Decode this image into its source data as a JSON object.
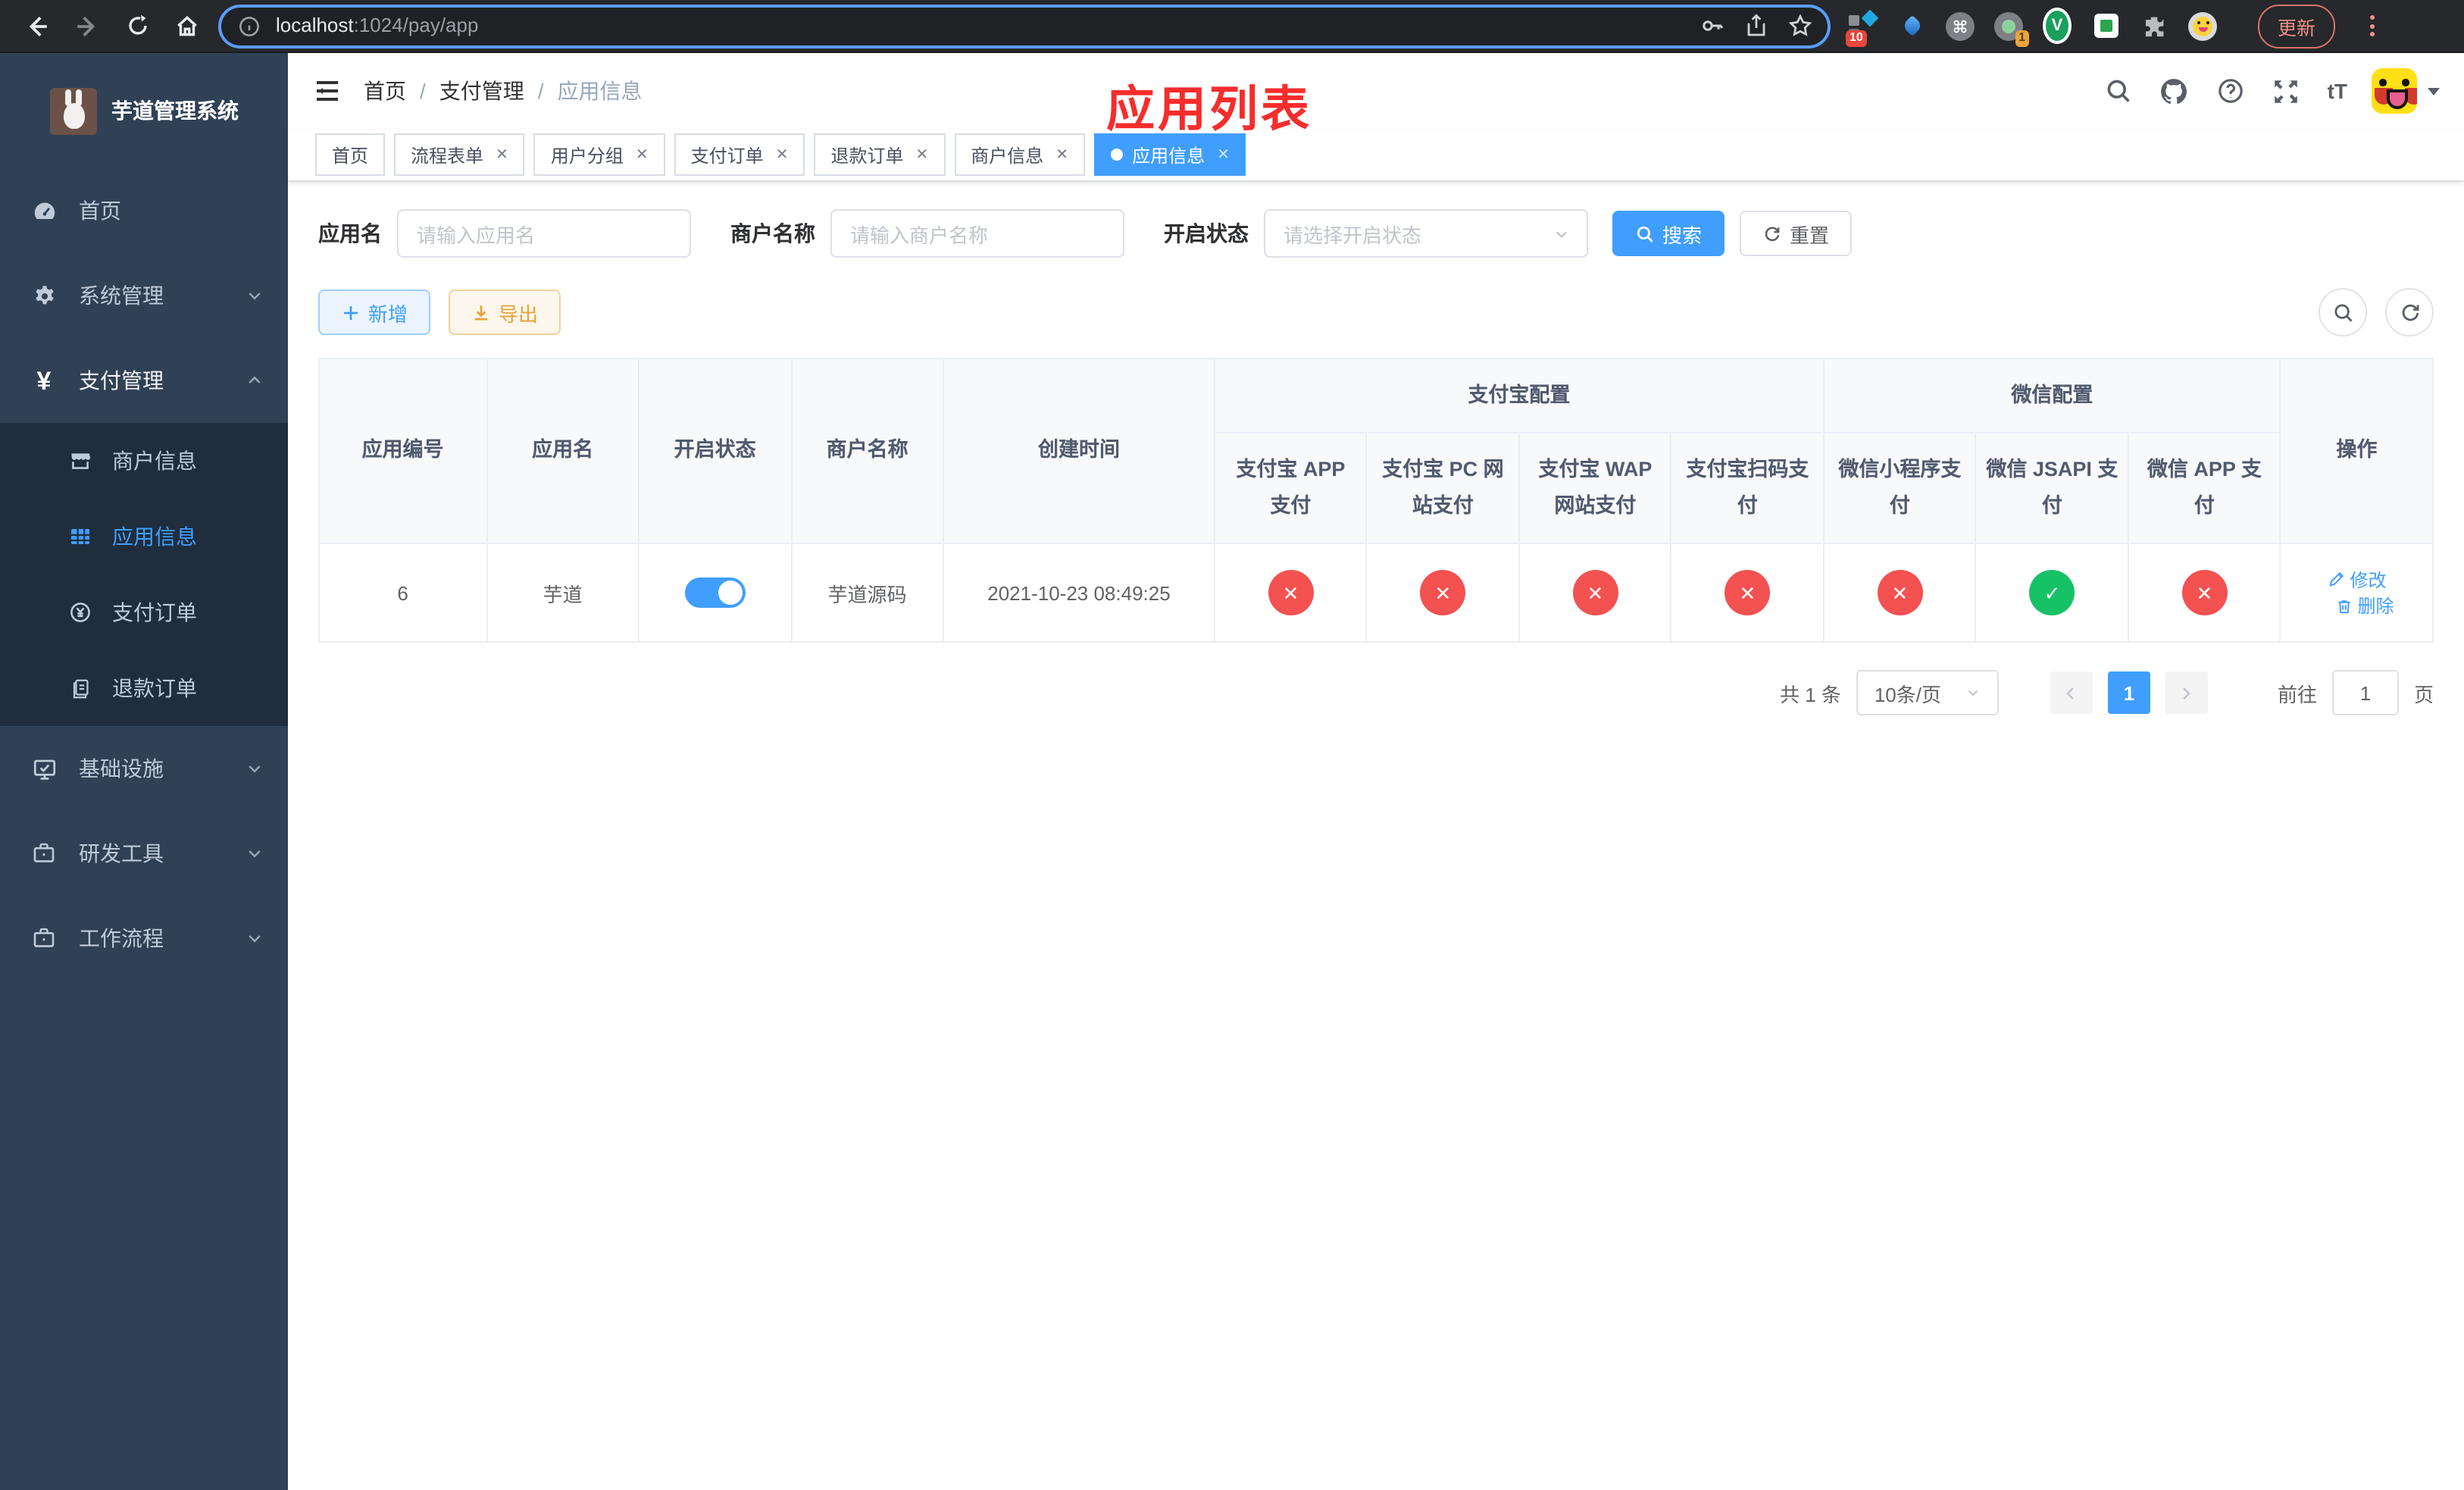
{
  "browser": {
    "url": {
      "host": "localhost",
      "path": ":1024/pay/app"
    },
    "update_button": "更新",
    "extension_badges": {
      "red": "10",
      "orange": "1"
    },
    "v_extension_letter": "V"
  },
  "sidebar": {
    "title": "芋道管理系统",
    "menu": [
      {
        "label": "首页"
      },
      {
        "label": "系统管理"
      },
      {
        "label": "支付管理"
      },
      {
        "label": "基础设施"
      },
      {
        "label": "研发工具"
      },
      {
        "label": "工作流程"
      }
    ],
    "submenu": [
      {
        "label": "商户信息"
      },
      {
        "label": "应用信息"
      },
      {
        "label": "支付订单"
      },
      {
        "label": "退款订单"
      }
    ],
    "yen_glyph": "¥"
  },
  "navbar": {
    "breadcrumb": [
      "首页",
      "支付管理",
      "应用信息"
    ],
    "separator": "/",
    "annotation": "应用列表",
    "font_size_icon": "tT"
  },
  "tabs": [
    {
      "label": "首页",
      "closable": false,
      "active": false
    },
    {
      "label": "流程表单",
      "closable": true,
      "active": false
    },
    {
      "label": "用户分组",
      "closable": true,
      "active": false
    },
    {
      "label": "支付订单",
      "closable": true,
      "active": false
    },
    {
      "label": "退款订单",
      "closable": true,
      "active": false
    },
    {
      "label": "商户信息",
      "closable": true,
      "active": false
    },
    {
      "label": "应用信息",
      "closable": true,
      "active": true
    }
  ],
  "filters": {
    "app_name_label": "应用名",
    "app_name_placeholder": "请输入应用名",
    "merchant_label": "商户名称",
    "merchant_placeholder": "请输入商户名称",
    "status_label": "开启状态",
    "status_placeholder": "请选择开启状态",
    "search_button": "搜索",
    "reset_button": "重置"
  },
  "actions": {
    "add_button": "新增",
    "export_button": "导出"
  },
  "table": {
    "columns": [
      "应用编号",
      "应用名",
      "开启状态",
      "商户名称",
      "创建时间"
    ],
    "groups": [
      {
        "label": "支付宝配置",
        "children": [
          "支付宝 APP 支付",
          "支付宝 PC 网站支付",
          "支付宝 WAP 网站支付",
          "支付宝扫码支付"
        ]
      },
      {
        "label": "微信配置",
        "children": [
          "微信小程序支付",
          "微信 JSAPI 支付",
          "微信 APP 支付"
        ]
      }
    ],
    "actions_column": "操作",
    "row": {
      "id": "6",
      "name": "芋道",
      "enabled": true,
      "merchant": "芋道源码",
      "created_at": "2021-10-23 08:49:25",
      "statuses": [
        "close",
        "close",
        "close",
        "close",
        "close",
        "check",
        "close"
      ],
      "edit": "修改",
      "delete": "删除"
    }
  },
  "pagination": {
    "total": "共 1 条",
    "page_size": "10条/页",
    "page": "1",
    "goto_label": "前往",
    "goto_value": "1",
    "page_suffix": "页"
  },
  "colors": {
    "primary": "#409eff",
    "success": "#17c267",
    "danger": "#f45151",
    "annotation": "#f72c2c"
  }
}
